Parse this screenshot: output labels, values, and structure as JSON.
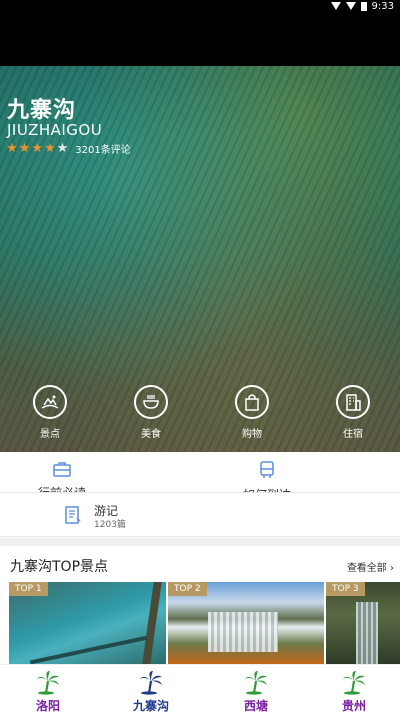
{
  "status_bar": {
    "time": "9:33"
  },
  "hero": {
    "title_cn": "九寨沟",
    "title_en": "JIUZHAIGOU",
    "rating": {
      "stars_on": 4,
      "stars_total": 5
    },
    "reviews": "3201条评论"
  },
  "quick_actions": [
    {
      "label": "景点",
      "icon": "scenic-icon"
    },
    {
      "label": "美食",
      "icon": "food-bowl-icon"
    },
    {
      "label": "购物",
      "icon": "shopping-bag-icon"
    },
    {
      "label": "住宿",
      "icon": "hotel-icon"
    }
  ],
  "info": {
    "prep_label": "行前必读",
    "route_label": "如何到达",
    "notes_title": "游记",
    "notes_count": "1203篇"
  },
  "top_section": {
    "title": "九寨沟TOP景点",
    "see_all": "查看全部"
  },
  "cards": [
    {
      "badge": "TOP 1"
    },
    {
      "badge": "TOP 2"
    },
    {
      "badge": "TOP 3"
    }
  ],
  "bottom_nav": [
    {
      "label": "洛阳",
      "color": "#7b1fa2"
    },
    {
      "label": "九寨沟",
      "color": "#1e3a8a"
    },
    {
      "label": "西塘",
      "color": "#7b1fa2"
    },
    {
      "label": "贵州",
      "color": "#7b1fa2"
    }
  ],
  "colors": {
    "accent_star": "#f0922a",
    "badge": "#b79a63",
    "palm": "#2e9b3a",
    "palm_active": "#1e3a8a"
  }
}
